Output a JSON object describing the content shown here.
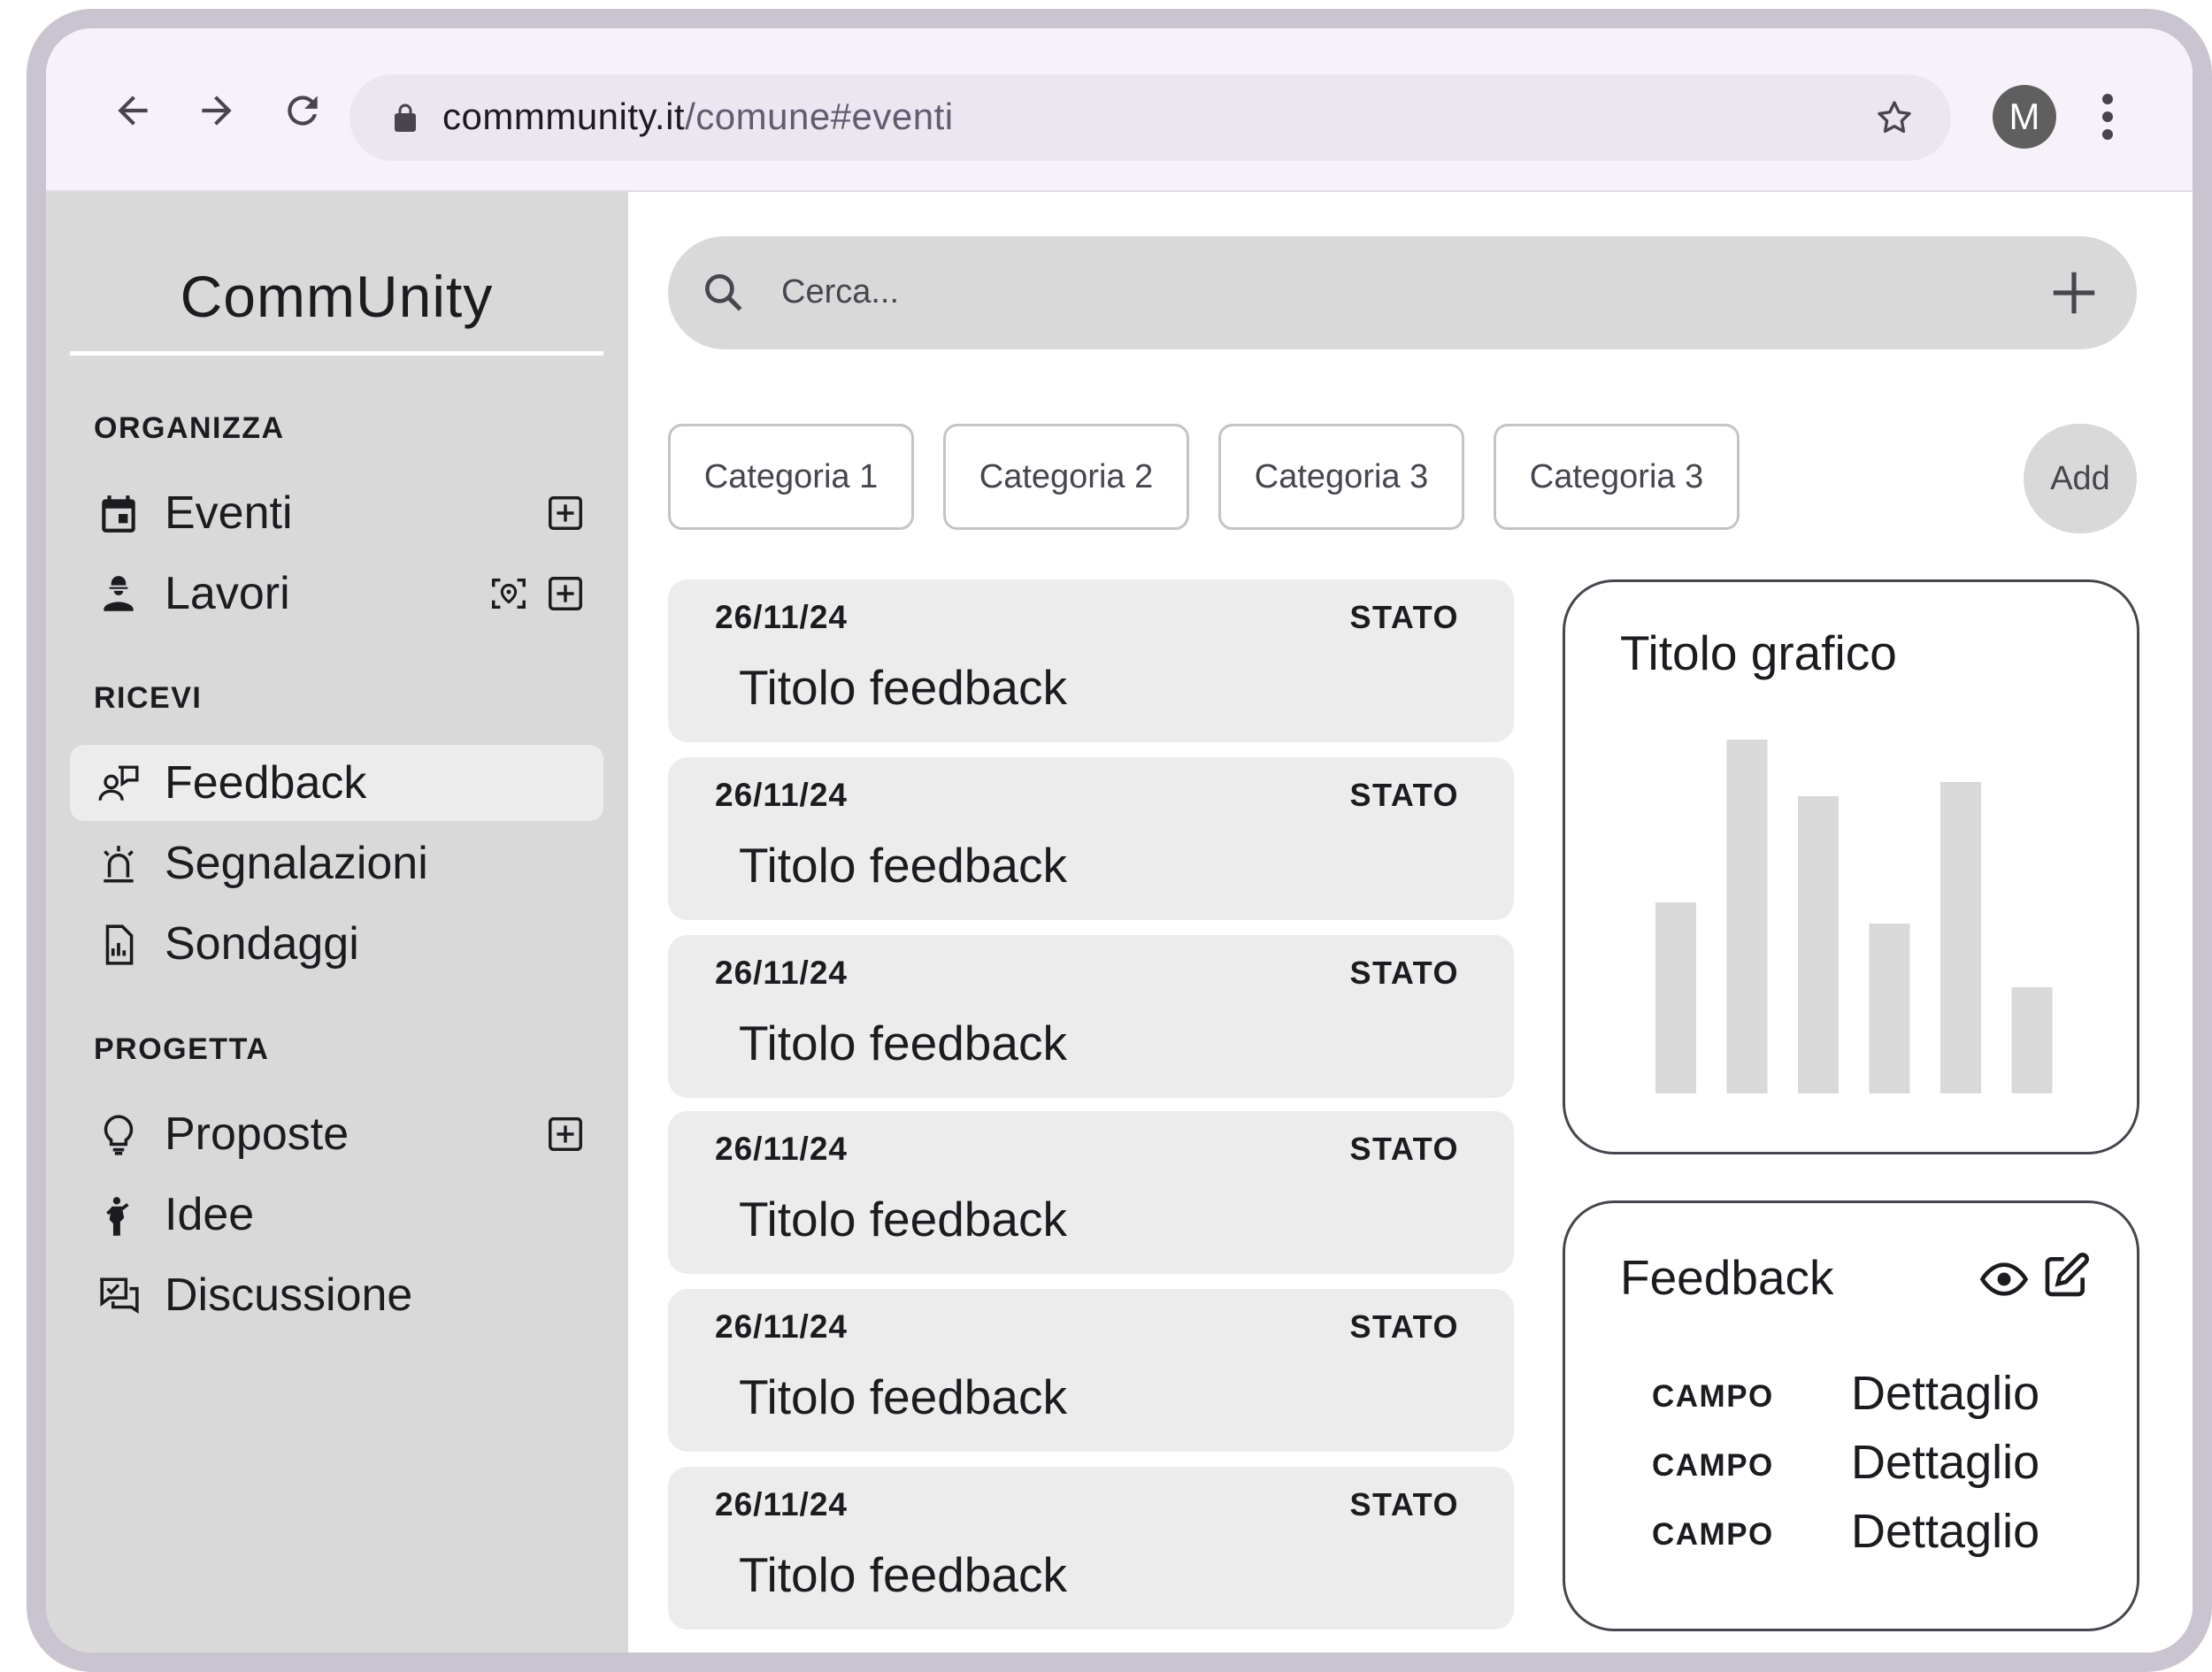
{
  "browser": {
    "url_host": "commmunity.it",
    "url_path": "/comune#eventi",
    "avatar_letter": "M"
  },
  "sidebar": {
    "brand": "CommUnity",
    "sections": [
      {
        "title": "ORGANIZZA",
        "items": [
          {
            "label": "Eventi",
            "icon": "calendar-icon"
          },
          {
            "label": "Lavori",
            "icon": "worker-icon"
          }
        ]
      },
      {
        "title": "RICEVI",
        "items": [
          {
            "label": "Feedback",
            "icon": "feedback-icon"
          },
          {
            "label": "Segnalazioni",
            "icon": "siren-icon"
          },
          {
            "label": "Sondaggi",
            "icon": "survey-icon"
          }
        ]
      },
      {
        "title": "PROGETTA",
        "items": [
          {
            "label": "Proposte",
            "icon": "lightbulb-icon"
          },
          {
            "label": "Idee",
            "icon": "person-idea-icon"
          },
          {
            "label": "Discussione",
            "icon": "discussion-icon"
          }
        ]
      }
    ],
    "active_item": "Feedback"
  },
  "search": {
    "placeholder": "Cerca..."
  },
  "categories": [
    "Categoria 1",
    "Categoria 2",
    "Categoria 3",
    "Categoria 3"
  ],
  "add_label": "Add",
  "feedback_list": [
    {
      "date": "26/11/24",
      "status": "STATO",
      "title": "Titolo feedback"
    },
    {
      "date": "26/11/24",
      "status": "STATO",
      "title": "Titolo feedback"
    },
    {
      "date": "26/11/24",
      "status": "STATO",
      "title": "Titolo feedback"
    },
    {
      "date": "26/11/24",
      "status": "STATO",
      "title": "Titolo feedback"
    },
    {
      "date": "26/11/24",
      "status": "STATO",
      "title": "Titolo feedback"
    },
    {
      "date": "26/11/24",
      "status": "STATO",
      "title": "Titolo feedback"
    }
  ],
  "chart_card": {
    "title": "Titolo grafico"
  },
  "chart_data": {
    "type": "bar",
    "title": "Titolo grafico",
    "categories": [
      "",
      "",
      "",
      "",
      "",
      ""
    ],
    "values": [
      54,
      100,
      84,
      48,
      88,
      30
    ],
    "ylim": [
      0,
      100
    ],
    "grid": false,
    "bar_color": "#d9d9d9"
  },
  "detail_card": {
    "title": "Feedback",
    "rows": [
      {
        "field": "CAMPO",
        "value": "Dettaglio"
      },
      {
        "field": "CAMPO",
        "value": "Dettaglio"
      },
      {
        "field": "CAMPO",
        "value": "Dettaglio"
      }
    ]
  },
  "colors": {
    "sidebar_bg": "#d9d9d9",
    "card_bg": "#ececec",
    "chrome_bg": "#f7f2fa",
    "frame": "#cac4d0"
  }
}
